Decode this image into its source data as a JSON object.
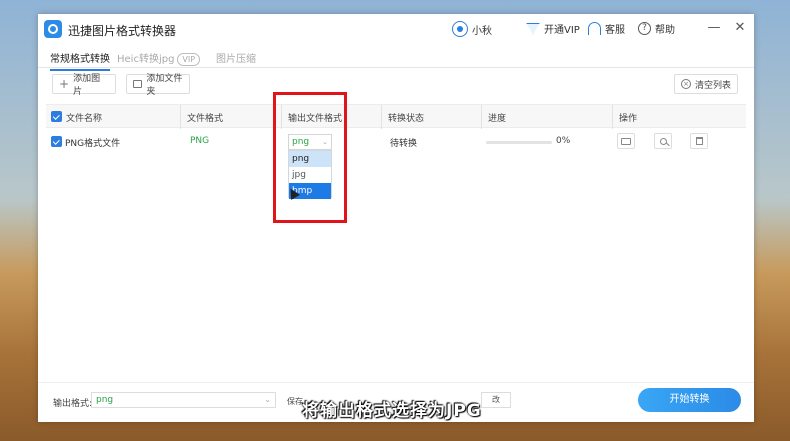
{
  "app": {
    "title": "迅捷图片格式转换器"
  },
  "titlebar": {
    "user_name": "小秋",
    "vip_label": "开通VIP",
    "service_label": "客服",
    "help_label": "帮助",
    "minimize": "—",
    "close": "✕"
  },
  "tabs": [
    {
      "label": "常规格式转换"
    },
    {
      "label": "Heic转换jpg",
      "badge": "VIP"
    },
    {
      "label": "图片压缩"
    }
  ],
  "toolbar": {
    "add_image": "添加图片",
    "add_folder": "添加文件夹",
    "clear_list": "清空列表"
  },
  "table": {
    "headers": [
      "文件名称",
      "文件格式",
      "输出文件格式",
      "转换状态",
      "进度",
      "操作"
    ],
    "row": {
      "name": "PNG格式文件",
      "format": "PNG",
      "output_format": "png",
      "status": "待转换",
      "progress_text": "0%",
      "progress_fraction": 0
    }
  },
  "dropdown": {
    "options": [
      "png",
      "jpg",
      "bmp"
    ],
    "hovered": "png",
    "selected": "bmp"
  },
  "footer": {
    "output_label": "输出格式:",
    "output_value": "png",
    "save_label": "保存",
    "save_tail": "改"
  },
  "start_button": "开始转换",
  "caption": "将输出格式选择为JPG",
  "colors": {
    "accent": "#2b7de0",
    "highlight": "#e0141a",
    "format_green": "#2aa34a"
  }
}
